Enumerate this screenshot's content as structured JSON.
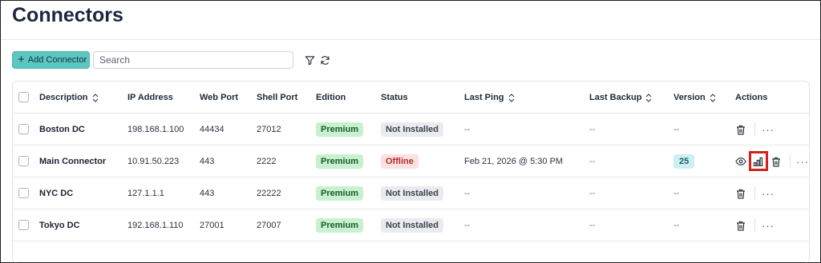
{
  "page": {
    "title": "Connectors"
  },
  "toolbar": {
    "add_label": "Add Connector",
    "search_placeholder": "Search",
    "filter_icon": "filter-icon",
    "refresh_icon": "refresh-icon"
  },
  "table": {
    "headers": {
      "description": "Description",
      "ip": "IP Address",
      "web_port": "Web Port",
      "shell_port": "Shell Port",
      "edition": "Edition",
      "status": "Status",
      "last_ping": "Last Ping",
      "last_backup": "Last Backup",
      "version": "Version",
      "actions": "Actions"
    },
    "rows": [
      {
        "description": "Boston DC",
        "ip": "198.168.1.100",
        "web_port": "44434",
        "shell_port": "27012",
        "edition": "Premium",
        "status": "Not Installed",
        "last_ping": "--",
        "last_backup": "--",
        "version": "--"
      },
      {
        "description": "Main Connector",
        "ip": "10.91.50.223",
        "web_port": "443",
        "shell_port": "2222",
        "edition": "Premium",
        "status": "Offline",
        "last_ping": "Feb 21, 2026 @ 5:30 PM",
        "last_backup": "--",
        "version": "25"
      },
      {
        "description": "NYC DC",
        "ip": "127.1.1.1",
        "web_port": "443",
        "shell_port": "22222",
        "edition": "Premium",
        "status": "Not Installed",
        "last_ping": "--",
        "last_backup": "--",
        "version": "--"
      },
      {
        "description": "Tokyo DC",
        "ip": "192.168.1.110",
        "web_port": "27001",
        "shell_port": "27007",
        "edition": "Premium",
        "status": "Not Installed",
        "last_ping": "--",
        "last_backup": "--",
        "version": "--"
      }
    ],
    "more_label": "···"
  },
  "colors": {
    "accent": "#5cc6c1",
    "premium": "#c9f0cf",
    "offline": "#fbe1e1",
    "highlight": "#d5201b"
  }
}
